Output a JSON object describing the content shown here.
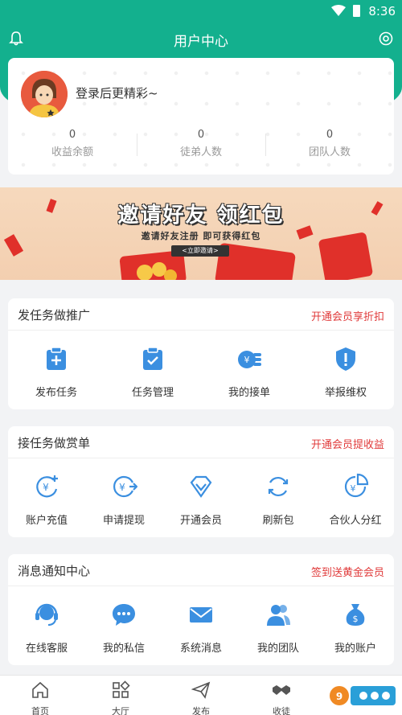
{
  "status_bar": {
    "time": "8:36"
  },
  "header": {
    "title": "用户中心"
  },
  "user": {
    "login_prompt": "登录后更精彩~",
    "stats": [
      {
        "value": "0",
        "label": "收益余额"
      },
      {
        "value": "0",
        "label": "徒弟人数"
      },
      {
        "value": "0",
        "label": "团队人数"
      }
    ]
  },
  "banner": {
    "headline": "邀请好友  领红包",
    "subline": "邀请好友注册  即可获得红包",
    "cta": "<立即邀请>"
  },
  "sections": [
    {
      "title": "发任务做推广",
      "link": "开通会员享折扣",
      "items": [
        {
          "label": "发布任务",
          "icon": "publish-task-icon"
        },
        {
          "label": "任务管理",
          "icon": "task-manage-icon"
        },
        {
          "label": "我的接单",
          "icon": "my-orders-icon"
        },
        {
          "label": "举报维权",
          "icon": "report-icon"
        }
      ]
    },
    {
      "title": "接任务做赏单",
      "link": "开通会员提收益",
      "items": [
        {
          "label": "账户充值",
          "icon": "recharge-icon"
        },
        {
          "label": "申请提现",
          "icon": "withdraw-icon"
        },
        {
          "label": "开通会员",
          "icon": "vip-diamond-icon"
        },
        {
          "label": "刷新包",
          "icon": "refresh-icon"
        },
        {
          "label": "合伙人分红",
          "icon": "partner-dividend-icon"
        }
      ]
    },
    {
      "title": "消息通知中心",
      "link": "签到送黄金会员",
      "items": [
        {
          "label": "在线客服",
          "icon": "customer-service-icon"
        },
        {
          "label": "我的私信",
          "icon": "private-message-icon"
        },
        {
          "label": "系统消息",
          "icon": "system-message-icon"
        },
        {
          "label": "我的团队",
          "icon": "my-team-icon"
        },
        {
          "label": "我的账户",
          "icon": "my-account-icon"
        }
      ]
    }
  ],
  "tabbar": [
    {
      "label": "首页",
      "icon": "home-icon"
    },
    {
      "label": "大厅",
      "icon": "hall-grid-icon"
    },
    {
      "label": "发布",
      "icon": "publish-plane-icon"
    },
    {
      "label": "收徒",
      "icon": "handshake-icon"
    }
  ],
  "colors": {
    "brand": "#13b08e",
    "icon_blue": "#3b8fe0",
    "link_red": "#e03a3a"
  }
}
